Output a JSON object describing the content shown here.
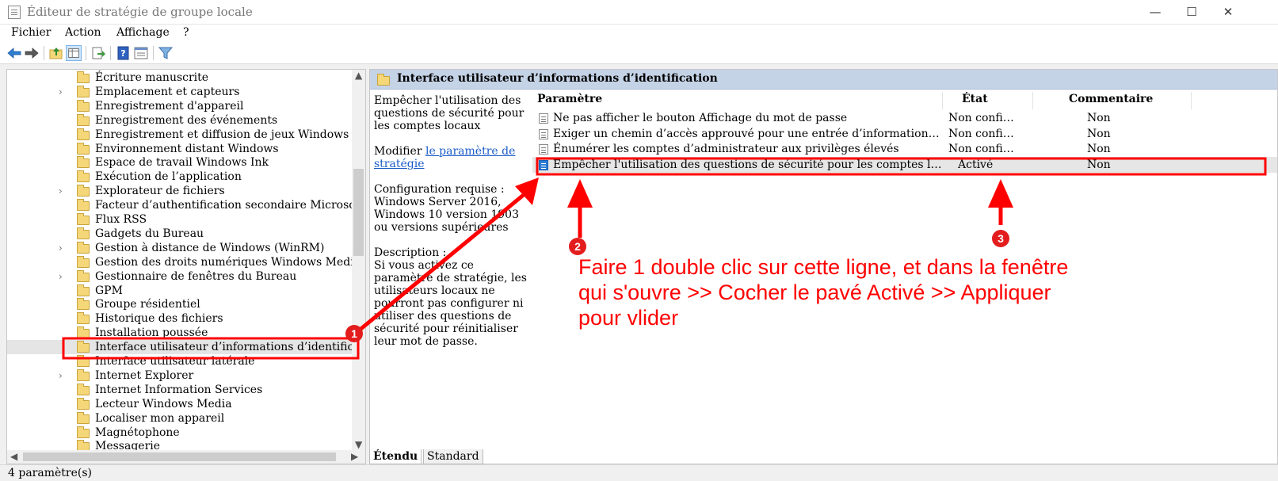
{
  "window": {
    "title": "Éditeur de stratégie de groupe locale",
    "minimize_glyph": "—",
    "maximize_glyph": "☐",
    "close_glyph": "✕"
  },
  "menu": [
    "Fichier",
    "Action",
    "Affichage",
    "?"
  ],
  "toolbar_icons": [
    "back-icon",
    "forward-icon",
    "up-folder-icon",
    "show-hide-tree-icon",
    "export-list-icon",
    "help-icon",
    "properties-icon",
    "filter-icon"
  ],
  "tree": {
    "items": [
      {
        "label": "Écriture manuscrite",
        "expandable": false
      },
      {
        "label": "Emplacement et capteurs",
        "expandable": true
      },
      {
        "label": "Enregistrement d'appareil",
        "expandable": false
      },
      {
        "label": "Enregistrement des événements",
        "expandable": false
      },
      {
        "label": "Enregistrement et diffusion de jeux Windows",
        "expandable": false
      },
      {
        "label": "Environnement distant Windows",
        "expandable": false
      },
      {
        "label": "Espace de travail Windows Ink",
        "expandable": false
      },
      {
        "label": "Exécution de l’application",
        "expandable": false
      },
      {
        "label": "Explorateur de fichiers",
        "expandable": true
      },
      {
        "label": "Facteur d’authentification secondaire Microsoft",
        "expandable": false
      },
      {
        "label": "Flux RSS",
        "expandable": false
      },
      {
        "label": "Gadgets du Bureau",
        "expandable": false
      },
      {
        "label": "Gestion à distance de Windows (WinRM)",
        "expandable": true
      },
      {
        "label": "Gestion des droits numériques Windows Media",
        "expandable": false
      },
      {
        "label": "Gestionnaire de fenêtres du Bureau",
        "expandable": true
      },
      {
        "label": "GPM",
        "expandable": false
      },
      {
        "label": "Groupe résidentiel",
        "expandable": false
      },
      {
        "label": "Historique des fichiers",
        "expandable": false
      },
      {
        "label": "Installation poussée",
        "expandable": false
      },
      {
        "label": "Interface utilisateur d’informations d’identification",
        "expandable": false,
        "selected": true
      },
      {
        "label": "Interface utilisateur latérale",
        "expandable": false
      },
      {
        "label": "Internet Explorer",
        "expandable": true
      },
      {
        "label": "Internet Information Services",
        "expandable": false
      },
      {
        "label": "Lecteur Windows Media",
        "expandable": false
      },
      {
        "label": "Localiser mon appareil",
        "expandable": false
      },
      {
        "label": "Magnétophone",
        "expandable": false
      },
      {
        "label": "Messagerie",
        "expandable": false
      }
    ]
  },
  "right": {
    "header_title": "Interface utilisateur d’informations d’identification",
    "desc_title": "Empêcher l'utilisation des questions de sécurité pour les comptes locaux",
    "modify_prefix": "Modifier ",
    "modify_link": "le paramètre de stratégie",
    "config_label": "Configuration requise :",
    "config_value": "Windows Server 2016, Windows 10 version 1903 ou versions supérieures",
    "description_label": "Description :",
    "description_value": "Si vous activez ce paramètre de stratégie, les utilisateurs locaux ne pourront pas configurer ni utiliser des questions de sécurité pour réinitialiser leur mot de passe.",
    "columns": {
      "param": "Paramètre",
      "state": "État",
      "comment": "Commentaire"
    },
    "rows": [
      {
        "param": "Ne pas afficher le bouton Affichage du mot de passe",
        "state": "Non configuré",
        "comment": "Non"
      },
      {
        "param": "Exiger un chemin d’accès approuvé pour une entrée d’informations d’identification",
        "state": "Non configuré",
        "comment": "Non"
      },
      {
        "param": "Énumérer les comptes d’administrateur aux privilèges élevés",
        "state": "Non configuré",
        "comment": "Non"
      },
      {
        "param": "Empêcher l'utilisation des questions de sécurité pour les comptes locaux",
        "state": "Activé",
        "comment": "Non",
        "selected": true
      }
    ]
  },
  "tabs": [
    "Étendu",
    "Standard"
  ],
  "status": "4 paramètre(s)",
  "annotation": {
    "text": "Faire 1 double clic sur cette ligne, et dans la fenêtre qui s'ouvre >> Cocher le pavé Activé  >> Appliquer pour vlider",
    "badges": [
      "1",
      "2",
      "3"
    ],
    "color": "#ff0000"
  }
}
